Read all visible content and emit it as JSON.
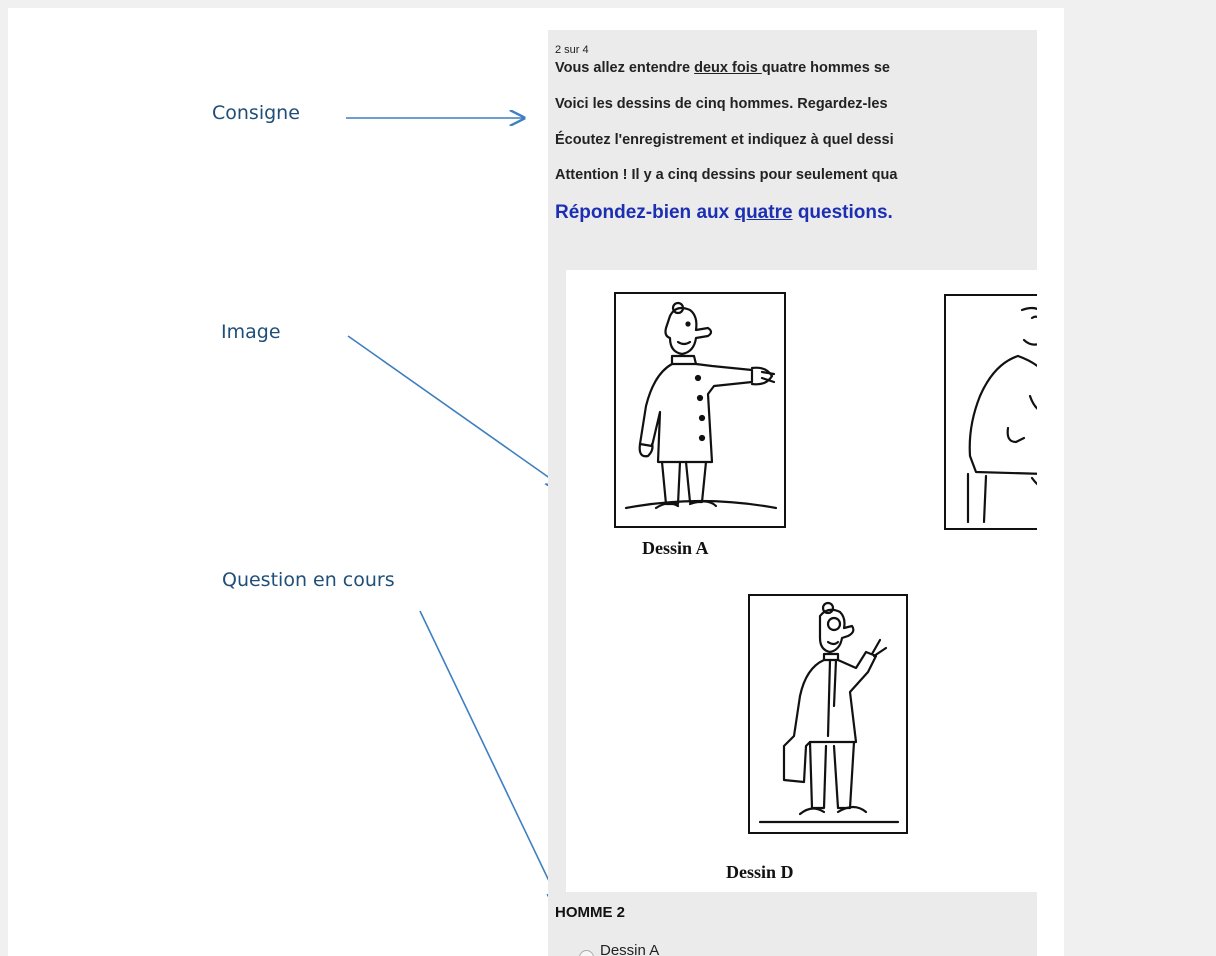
{
  "annotations": {
    "consigne": "Consigne",
    "image": "Image",
    "question": "Question en cours"
  },
  "screenshot": {
    "counter": "2  sur 4",
    "instructions": {
      "line1_pre": "Vous allez entendre ",
      "line1_underline": "deux fois ",
      "line1_post": "quatre hommes se",
      "line2": "Voici les dessins de cinq hommes. Regardez-les",
      "line3": "Écoutez l'enregistrement et indiquez à quel dessi",
      "line4": "Attention ! Il y a cinq dessins pour seulement qua"
    },
    "emphasis": {
      "pre": "Répondez-bien aux ",
      "underline": "quatre",
      "post": " questions."
    },
    "drawings": [
      {
        "caption": "Dessin A"
      },
      {
        "caption": "Dessin D"
      }
    ],
    "question": {
      "title": "HOMME 2",
      "options": [
        "Dessin A"
      ]
    }
  }
}
